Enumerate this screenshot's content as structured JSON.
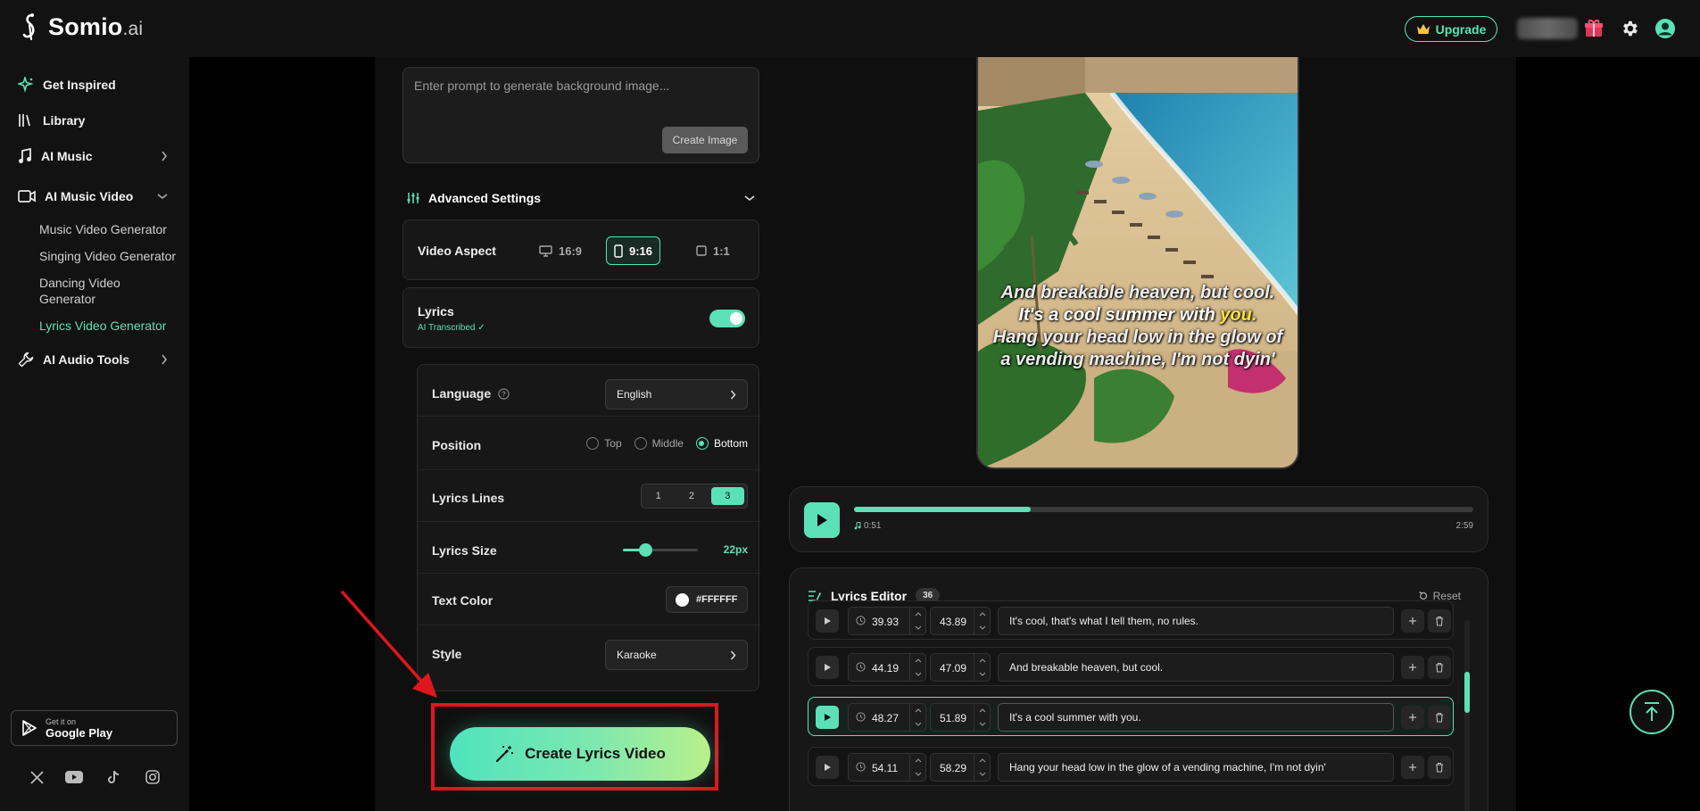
{
  "brand": {
    "name": "Somio",
    "suffix": ".ai"
  },
  "header": {
    "upgrade_label": "Upgrade"
  },
  "sidebar": {
    "items": [
      {
        "label": "Get Inspired",
        "icon": "sparkle-icon"
      },
      {
        "label": "Library",
        "icon": "library-icon"
      },
      {
        "label": "AI Music",
        "icon": "music-note-icon"
      },
      {
        "label": "AI Music Video",
        "icon": "video-camera-icon"
      },
      {
        "label": "AI Audio Tools",
        "icon": "wrench-icon"
      }
    ],
    "subitems": [
      {
        "label": "Music Video Generator"
      },
      {
        "label": "Singing Video Generator"
      },
      {
        "label": "Dancing Video Generator"
      },
      {
        "label": "Lyrics Video Generator"
      }
    ],
    "store": {
      "line1": "Get it on",
      "line2": "Google Play"
    }
  },
  "prompt": {
    "placeholder": "Enter prompt to generate background image...",
    "create_image_label": "Create Image"
  },
  "advanced": {
    "title": "Advanced Settings",
    "video_aspect": {
      "label": "Video Aspect",
      "options": [
        "16:9",
        "9:16",
        "1:1"
      ],
      "selected": "9:16"
    },
    "lyrics": {
      "label": "Lyrics",
      "sub": "AI Transcribed ✓",
      "enabled": true
    },
    "language": {
      "label": "Language",
      "value": "English"
    },
    "position": {
      "label": "Position",
      "options": [
        "Top",
        "Middle",
        "Bottom"
      ],
      "selected": "Bottom"
    },
    "lyrics_lines": {
      "label": "Lyrics Lines",
      "options": [
        "1",
        "2",
        "3"
      ],
      "selected": "3"
    },
    "lyrics_size": {
      "label": "Lyrics Size",
      "value": "22px",
      "fraction": 0.3
    },
    "text_color": {
      "label": "Text Color",
      "value": "#FFFFFF"
    },
    "style": {
      "label": "Style",
      "value": "Karaoke"
    }
  },
  "cta": {
    "label": "Create Lyrics Video"
  },
  "preview": {
    "line1": "And breakable heaven, but cool.",
    "line2_pre": "It's a cool summer with ",
    "line2_hl": "you.",
    "line3": "Hang your head low in the glow of a vending machine, I'm not dyin'"
  },
  "player": {
    "current": "0:51",
    "total": "2:59",
    "progress": 0.285
  },
  "editor": {
    "title": "Lyrics Editor",
    "count": "36",
    "reset_label": "Reset",
    "rows": [
      {
        "start": "39.93",
        "end": "43.89",
        "text": "It's cool, that's what I tell them, no rules.",
        "active": false
      },
      {
        "start": "44.19",
        "end": "47.09",
        "text": "And breakable heaven, but cool.",
        "active": false
      },
      {
        "start": "48.27",
        "end": "51.89",
        "text": "It's a cool summer with you.",
        "active": true
      },
      {
        "start": "54.11",
        "end": "58.29",
        "text": "Hang your head low in the glow of a vending machine, I'm not dyin'",
        "active": false
      }
    ]
  },
  "colors": {
    "accent": "#5ce1b6",
    "highlight": "#e0161e",
    "karaoke": "#ffe23a"
  }
}
